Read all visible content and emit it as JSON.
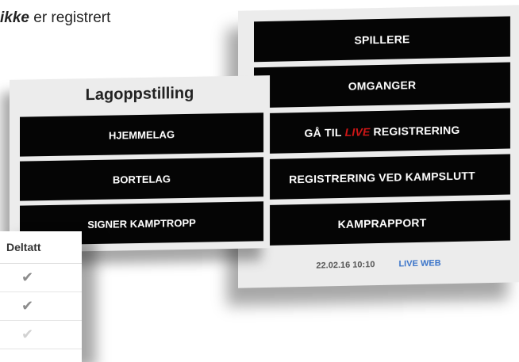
{
  "intro": {
    "emph": "ikke",
    "rest": " er registrert"
  },
  "match_menu": {
    "buttons": [
      {
        "label": "SPILLERE"
      },
      {
        "label": "OMGANGER"
      },
      {
        "pre": "GÅ TIL",
        "live": "LIVE",
        "post": "REGISTRERING"
      },
      {
        "label": "REGISTRERING VED KAMPSLUTT"
      },
      {
        "label": "KAMPRAPPORT"
      }
    ],
    "datetime": "22.02.16 10:10",
    "live_web": "LIVE WEB",
    "colors": {
      "button_bg": "#050505",
      "live_accent": "#d01616",
      "link": "#3a74c9"
    }
  },
  "lineup": {
    "title": "Lagoppstilling",
    "buttons": [
      {
        "label": "HJEMMELAG"
      },
      {
        "label": "BORTELAG"
      },
      {
        "label": "SIGNER KAMPTROPP"
      }
    ]
  },
  "participation": {
    "header": "Deltatt",
    "rows": [
      {
        "icon": "check-icon",
        "state": "checked"
      },
      {
        "icon": "check-icon",
        "state": "checked"
      },
      {
        "icon": "check-icon",
        "state": "faint"
      }
    ]
  }
}
